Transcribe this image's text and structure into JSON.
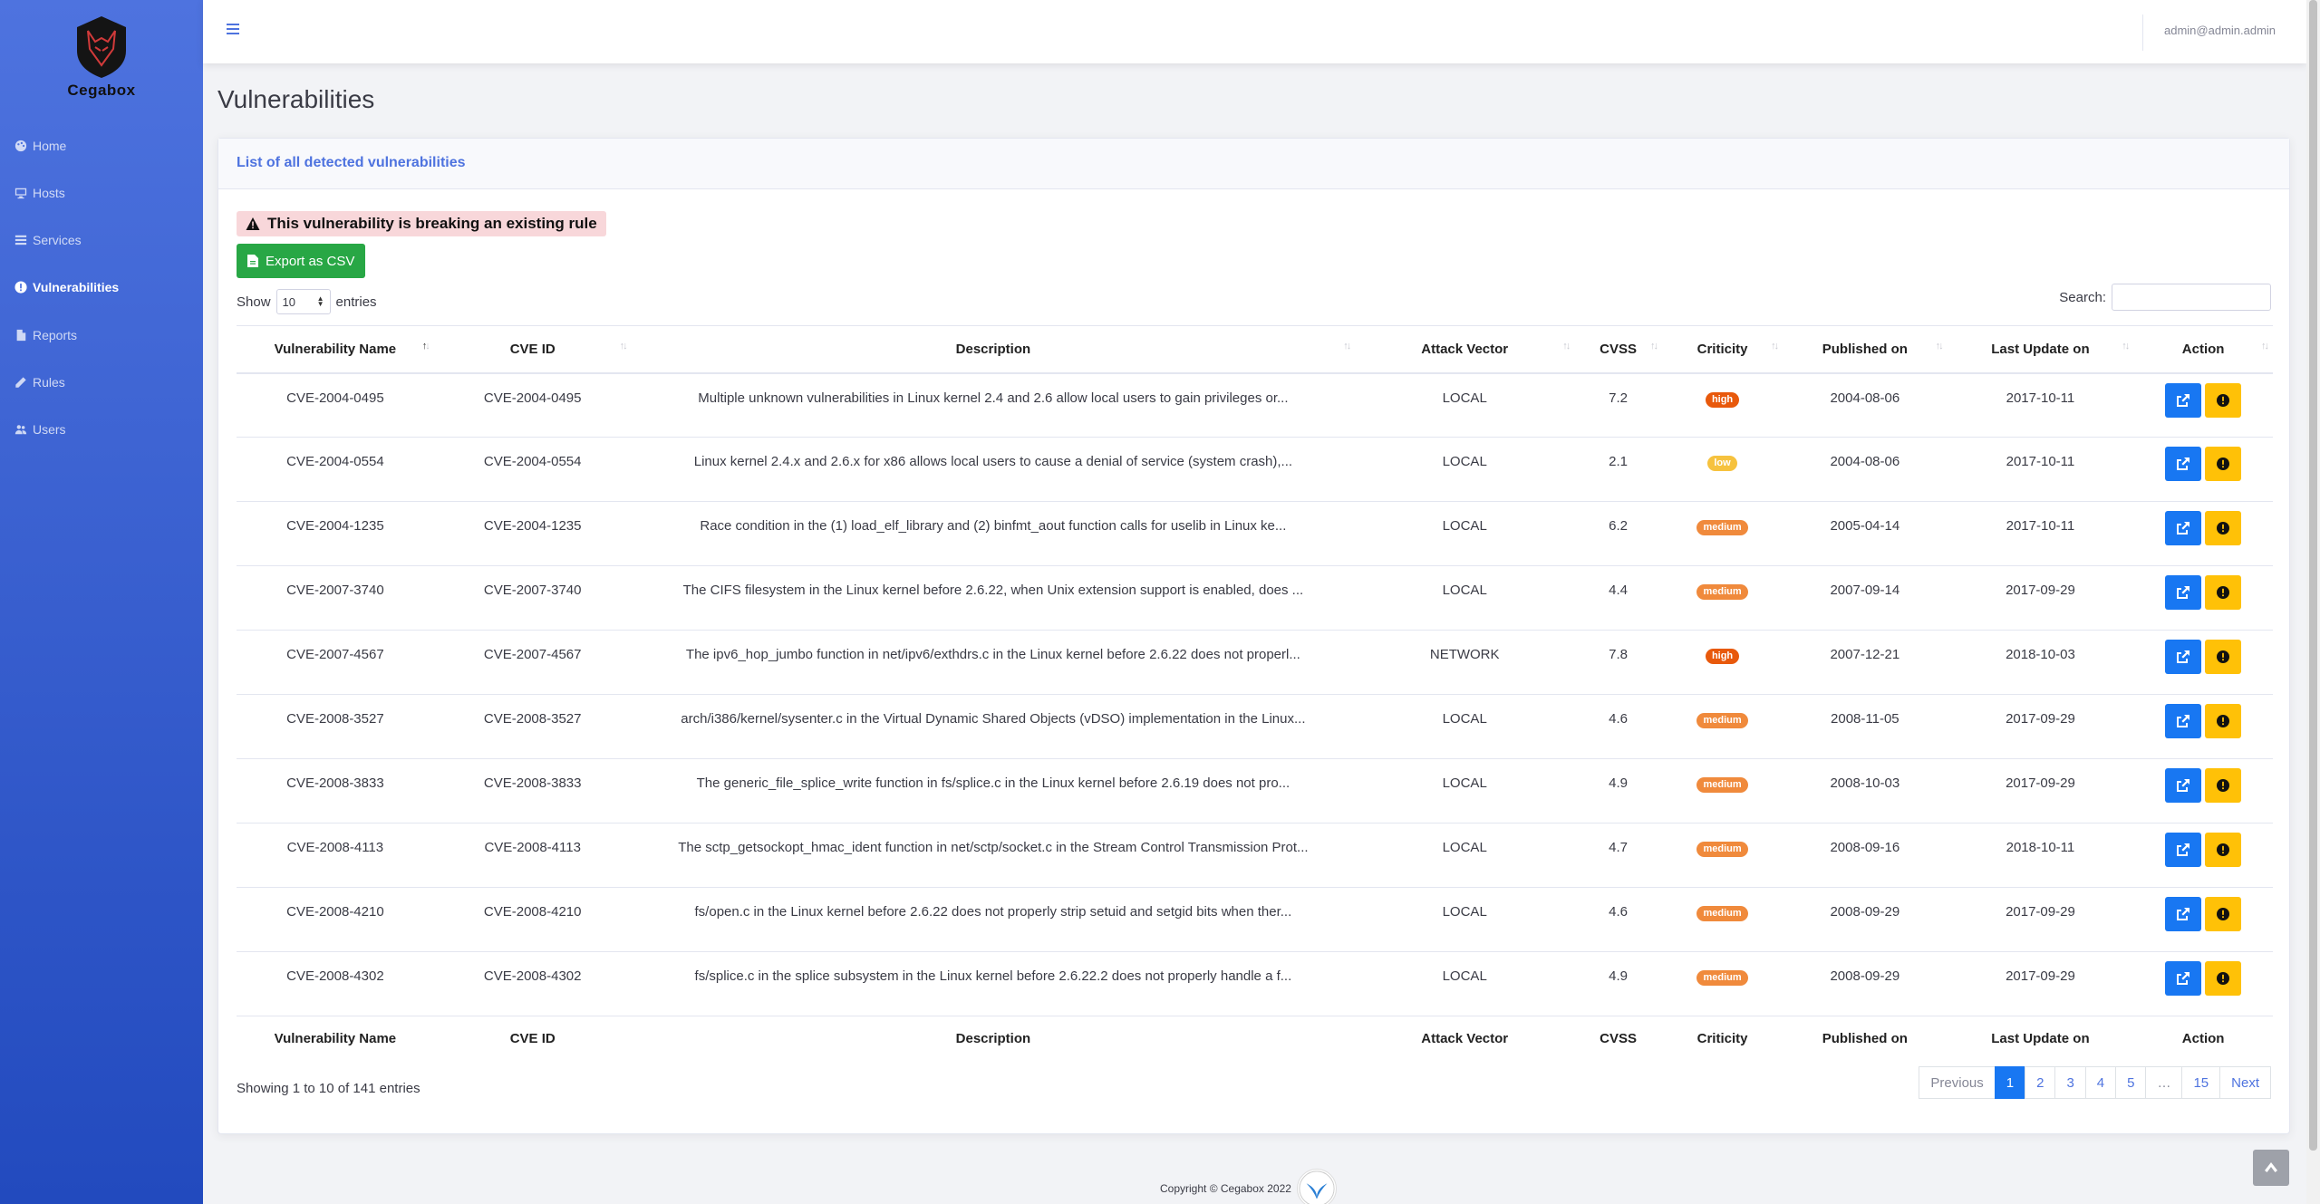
{
  "sidebar": {
    "brand": "Cegabox",
    "items": [
      {
        "label": "Home",
        "icon": "palette-icon"
      },
      {
        "label": "Hosts",
        "icon": "desktop-icon"
      },
      {
        "label": "Services",
        "icon": "list-icon"
      },
      {
        "label": "Vulnerabilities",
        "icon": "alert-circle-icon",
        "active": true
      },
      {
        "label": "Reports",
        "icon": "file-icon"
      },
      {
        "label": "Rules",
        "icon": "pencil-icon"
      },
      {
        "label": "Users",
        "icon": "users-icon"
      }
    ]
  },
  "topbar": {
    "user_email": "admin@admin.admin"
  },
  "page": {
    "title": "Vulnerabilities"
  },
  "card": {
    "header": "List of all detected vulnerabilities",
    "alert": "This vulnerability is breaking an existing rule",
    "export_label": "Export as CSV",
    "show_label": "Show",
    "entries_value": "10",
    "entries_label": "entries",
    "search_label": "Search:",
    "search_value": ""
  },
  "table": {
    "columns": [
      "Vulnerability Name",
      "CVE ID",
      "Description",
      "Attack Vector",
      "CVSS",
      "Criticity",
      "Published on",
      "Last Update on",
      "Action"
    ],
    "rows": [
      {
        "name": "CVE-2004-0495",
        "cve": "CVE-2004-0495",
        "desc": "Multiple unknown vulnerabilities in Linux kernel 2.4 and 2.6 allow local users to gain privileges or...",
        "vector": "LOCAL",
        "cvss": "7.2",
        "criticity": "high",
        "published": "2004-08-06",
        "updated": "2017-10-11"
      },
      {
        "name": "CVE-2004-0554",
        "cve": "CVE-2004-0554",
        "desc": "Linux kernel 2.4.x and 2.6.x for x86 allows local users to cause a denial of service (system crash),...",
        "vector": "LOCAL",
        "cvss": "2.1",
        "criticity": "low",
        "published": "2004-08-06",
        "updated": "2017-10-11"
      },
      {
        "name": "CVE-2004-1235",
        "cve": "CVE-2004-1235",
        "desc": "Race condition in the (1) load_elf_library and (2) binfmt_aout function calls for uselib in Linux ke...",
        "vector": "LOCAL",
        "cvss": "6.2",
        "criticity": "medium",
        "published": "2005-04-14",
        "updated": "2017-10-11"
      },
      {
        "name": "CVE-2007-3740",
        "cve": "CVE-2007-3740",
        "desc": "The CIFS filesystem in the Linux kernel before 2.6.22, when Unix extension support is enabled, does ...",
        "vector": "LOCAL",
        "cvss": "4.4",
        "criticity": "medium",
        "published": "2007-09-14",
        "updated": "2017-09-29"
      },
      {
        "name": "CVE-2007-4567",
        "cve": "CVE-2007-4567",
        "desc": "The ipv6_hop_jumbo function in net/ipv6/exthdrs.c in the Linux kernel before 2.6.22 does not properl...",
        "vector": "NETWORK",
        "cvss": "7.8",
        "criticity": "high",
        "published": "2007-12-21",
        "updated": "2018-10-03"
      },
      {
        "name": "CVE-2008-3527",
        "cve": "CVE-2008-3527",
        "desc": "arch/i386/kernel/sysenter.c in the Virtual Dynamic Shared Objects (vDSO) implementation in the Linux...",
        "vector": "LOCAL",
        "cvss": "4.6",
        "criticity": "medium",
        "published": "2008-11-05",
        "updated": "2017-09-29"
      },
      {
        "name": "CVE-2008-3833",
        "cve": "CVE-2008-3833",
        "desc": "The generic_file_splice_write function in fs/splice.c in the Linux kernel before 2.6.19 does not pro...",
        "vector": "LOCAL",
        "cvss": "4.9",
        "criticity": "medium",
        "published": "2008-10-03",
        "updated": "2017-09-29"
      },
      {
        "name": "CVE-2008-4113",
        "cve": "CVE-2008-4113",
        "desc": "The sctp_getsockopt_hmac_ident function in net/sctp/socket.c in the Stream Control Transmission Prot...",
        "vector": "LOCAL",
        "cvss": "4.7",
        "criticity": "medium",
        "published": "2008-09-16",
        "updated": "2018-10-11"
      },
      {
        "name": "CVE-2008-4210",
        "cve": "CVE-2008-4210",
        "desc": "fs/open.c in the Linux kernel before 2.6.22 does not properly strip setuid and setgid bits when ther...",
        "vector": "LOCAL",
        "cvss": "4.6",
        "criticity": "medium",
        "published": "2008-09-29",
        "updated": "2017-09-29"
      },
      {
        "name": "CVE-2008-4302",
        "cve": "CVE-2008-4302",
        "desc": "fs/splice.c in the splice subsystem in the Linux kernel before 2.6.22.2 does not properly handle a f...",
        "vector": "LOCAL",
        "cvss": "4.9",
        "criticity": "medium",
        "published": "2008-09-29",
        "updated": "2017-09-29"
      }
    ]
  },
  "pagination": {
    "info": "Showing 1 to 10 of 141 entries",
    "previous": "Previous",
    "pages": [
      "1",
      "2",
      "3",
      "4",
      "5",
      "…",
      "15"
    ],
    "active": "1",
    "next": "Next"
  },
  "footer": {
    "copyright": "Copyright © Cegabox 2022"
  },
  "colors": {
    "primary": "#4e73df",
    "success": "#28a745",
    "info": "#1877f2",
    "warning": "#ffc107",
    "high": "#e8590c",
    "medium": "#f08a3c",
    "low": "#f6c23e"
  }
}
